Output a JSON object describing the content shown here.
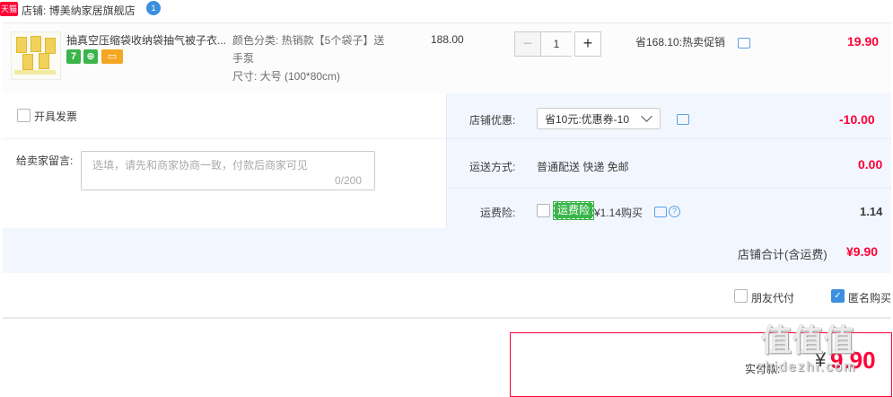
{
  "shop": {
    "badge": "天猫",
    "label": "店铺: 博美纳家居旗舰店",
    "ww": "1"
  },
  "item": {
    "title": "抽真空压缩袋收纳袋抽气被子衣...",
    "services": [
      "7",
      "⊕",
      "▭"
    ],
    "sku_color": "颜色分类: 热销款【5个袋子】送",
    "sku_color2": "手泵",
    "sku_size": "尺寸: 大号 (100*80cm)",
    "unit_price": "188.00",
    "qty_minus": "−",
    "qty": "1",
    "qty_plus": "+",
    "promo": "省168.10:热卖促销",
    "total": "19.90"
  },
  "invoice": {
    "label": "开具发票"
  },
  "message": {
    "label": "给卖家留言:",
    "placeholder": "选填，请先和商家协商一致，付款后商家可见",
    "count": "0/200"
  },
  "coupon": {
    "label": "店铺优惠:",
    "selected": "省10元:优惠券-10",
    "value": "-10.00"
  },
  "shipping": {
    "label": "运送方式:",
    "method": "普通配送 快递 免邮",
    "value": "0.00"
  },
  "insurance": {
    "label": "运费险:",
    "tag": "运费险",
    "desc": "¥1.14购买",
    "value": "1.14",
    "help": "?"
  },
  "subtotal": {
    "label": "店铺合计(含运费)",
    "value": "¥9.90"
  },
  "options": {
    "friend_pay": "朋友代付",
    "anon_check": "✓",
    "anonymous": "匿名购买"
  },
  "pay": {
    "label": "实付款:",
    "yen": "¥",
    "value": "9.90"
  },
  "watermark": {
    "text": "值值值",
    "site": "zhidezhi.com"
  }
}
